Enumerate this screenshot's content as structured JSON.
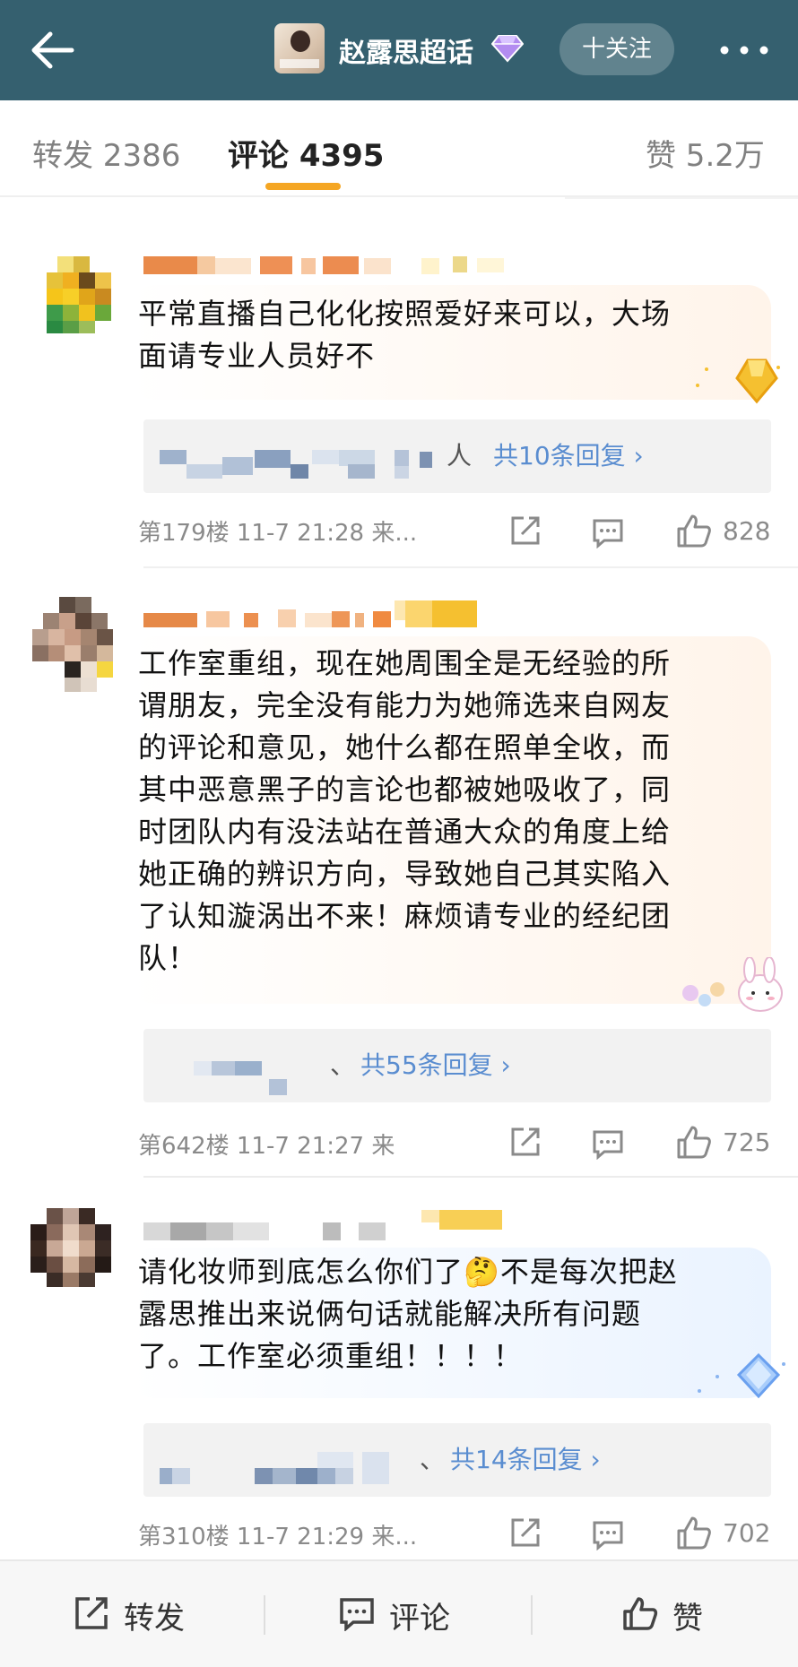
{
  "header": {
    "title": "赵露思超话",
    "follow_label": "十关注"
  },
  "tabs": {
    "repost": "转发 2386",
    "comment": "评论 4395",
    "like": "赞 5.2万"
  },
  "comments": [
    {
      "text_lines": [
        "平常直播自己化化按照爱好来可以，大场",
        "面请专业人员好不"
      ],
      "reply_prefix": "人",
      "reply_link": "共10条回复 ›",
      "meta": "第179楼  11-7 21:28  来...",
      "likes": "828"
    },
    {
      "text_lines": [
        "工作室重组，现在她周围全是无经验的所",
        "谓朋友，完全没有能力为她筛选来自网友",
        "的评论和意见，她什么都在照单全收，而",
        "其中恶意黑子的言论也都被她吸收了，同",
        "时团队内有没法站在普通大众的角度上给",
        "她正确的辨识方向，导致她自己其实陷入",
        "了认知漩涡出不来！麻烦请专业的经纪团",
        "队！"
      ],
      "reply_prefix": "、",
      "reply_link": "共55条回复 ›",
      "meta": "第642楼  11-7 21:27  来",
      "likes": "725"
    },
    {
      "text_lines": [
        "请化妆师到底怎么你们了🤔不是每次把赵",
        "露思推出来说俩句话就能解决所有问题",
        "了。工作室必须重组！！！！"
      ],
      "reply_prefix": "、",
      "reply_link": "共14条回复 ›",
      "meta": "第310楼  11-7 21:29  来...",
      "likes": "702"
    }
  ],
  "bottom": {
    "repost": "转发",
    "comment": "评论",
    "like": "赞"
  },
  "colors": {
    "topbar": "#35606f",
    "accent": "#f5a623",
    "link": "#5a8dd0"
  }
}
